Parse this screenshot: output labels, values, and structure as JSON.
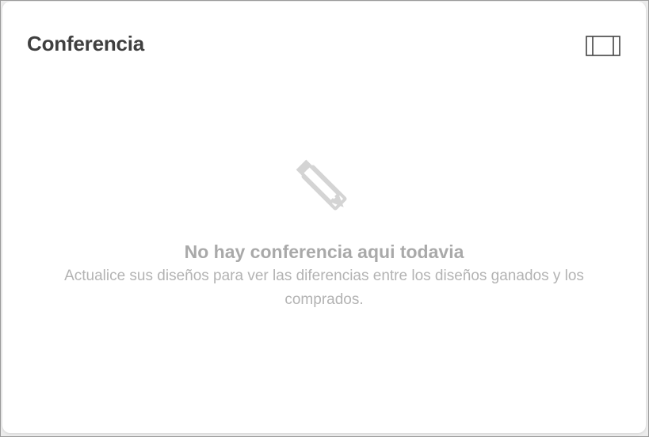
{
  "card": {
    "title": "Conferencia",
    "toggle_icon": "panel-layout-icon"
  },
  "empty_state": {
    "icon": "design-tools-icon",
    "title": "No hay conferencia aqui todavia",
    "description": "Actualice sus diseños para ver las diferencias entre los diseños ganados y los comprados."
  },
  "colors": {
    "title": "#3f3f3f",
    "muted_title": "#a9a9a9",
    "muted_text": "#b3b3b3",
    "icon": "#d4d4d4",
    "card_bg": "#ffffff"
  }
}
